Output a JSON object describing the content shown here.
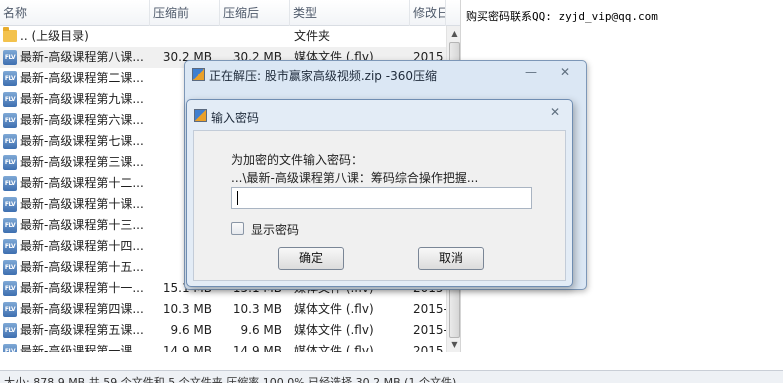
{
  "columns": {
    "name": "名称",
    "size": "压缩前",
    "csize": "压缩后",
    "type": "类型",
    "date": "修改日"
  },
  "rows": [
    {
      "name": ".. (上级目录)",
      "size": "",
      "csize": "",
      "type": "文件夹",
      "date": "",
      "icon": "folder-icon"
    },
    {
      "name": "最新-高级课程第八课...",
      "size": "30.2 MB",
      "csize": "30.2 MB",
      "type": "媒体文件 (.flv)",
      "date": "2015",
      "icon": "flv-file-icon"
    },
    {
      "name": "最新-高级课程第二课...",
      "size": "18.",
      "csize": "",
      "type": "",
      "date": "",
      "icon": "flv-file-icon"
    },
    {
      "name": "最新-高级课程第九课...",
      "size": "18.",
      "csize": "",
      "type": "",
      "date": "",
      "icon": "flv-file-icon"
    },
    {
      "name": "最新-高级课程第六课...",
      "size": "16.",
      "csize": "",
      "type": "",
      "date": "",
      "icon": "flv-file-icon"
    },
    {
      "name": "最新-高级课程第七课...",
      "size": "23.",
      "csize": "",
      "type": "",
      "date": "",
      "icon": "flv-file-icon"
    },
    {
      "name": "最新-高级课程第三课...",
      "size": "19.",
      "csize": "",
      "type": "",
      "date": "",
      "icon": "flv-file-icon"
    },
    {
      "name": "最新-高级课程第十二...",
      "size": "20.",
      "csize": "",
      "type": "",
      "date": "",
      "icon": "flv-file-icon"
    },
    {
      "name": "最新-高级课程第十课...",
      "size": "43.",
      "csize": "",
      "type": "",
      "date": "",
      "icon": "flv-file-icon"
    },
    {
      "name": "最新-高级课程第十三...",
      "size": "18.",
      "csize": "",
      "type": "",
      "date": "",
      "icon": "flv-file-icon"
    },
    {
      "name": "最新-高级课程第十四...",
      "size": "12.",
      "csize": "",
      "type": "",
      "date": "",
      "icon": "flv-file-icon"
    },
    {
      "name": "最新-高级课程第十五...",
      "size": "16.",
      "csize": "",
      "type": "",
      "date": "",
      "icon": "flv-file-icon"
    },
    {
      "name": "最新-高级课程第十一...",
      "size": "15.1 MB",
      "csize": "15.1 MB",
      "type": "媒体文件 (.flv)",
      "date": "2015-",
      "icon": "flv-file-icon"
    },
    {
      "name": "最新-高级课程第四课...",
      "size": "10.3 MB",
      "csize": "10.3 MB",
      "type": "媒体文件 (.flv)",
      "date": "2015-",
      "icon": "flv-file-icon"
    },
    {
      "name": "最新-高级课程第五课...",
      "size": "9.6 MB",
      "csize": "9.6 MB",
      "type": "媒体文件 (.flv)",
      "date": "2015-",
      "icon": "flv-file-icon"
    },
    {
      "name": "最新-高级课程第一课...",
      "size": "14.9 MB",
      "csize": "14.9 MB",
      "type": "媒体文件 (.flv)",
      "date": "2015",
      "icon": "flv-file-icon"
    }
  ],
  "comment": "购买密码联系QQ: zyjd_vip@qq.com",
  "status": "大小: 878.9 MB 共 59 个文件和 5 个文件夹 压缩率 100.0% 已经选择 30.2 MB (1 个文件)",
  "extract_dialog": {
    "title": "正在解压: 股市赢家高级视频.zip -360压缩",
    "minimize": "—",
    "close": "✕"
  },
  "password_dialog": {
    "title": "输入密码",
    "close": "✕",
    "prompt": "为加密的文件输入密码：",
    "file": "...\\最新-高级课程第八课：筹码综合操作把握...",
    "input_value": "",
    "show_password_label": "显示密码",
    "ok_label": "确定",
    "cancel_label": "取消"
  },
  "flv_icon_text": "FLV",
  "colors": {
    "dialog_frame": "#dbe7f4",
    "selected_row": "#f0f0f0",
    "header_text": "#4f5a6b"
  }
}
